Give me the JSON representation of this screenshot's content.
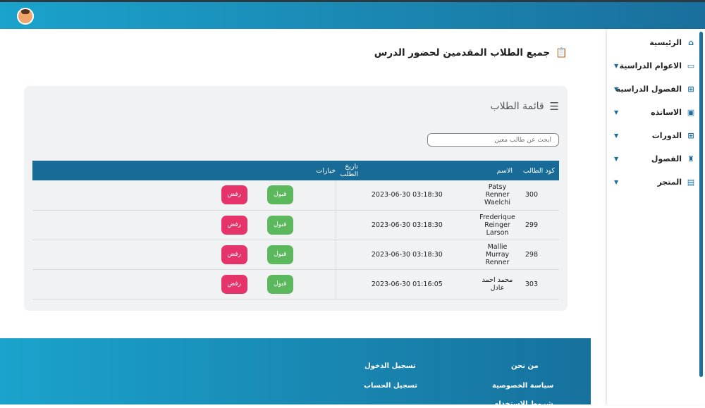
{
  "sidebar": {
    "items": [
      {
        "label": "الرئيسية",
        "icon": "home-icon",
        "caret": false
      },
      {
        "label": "الاعوام الدراسية",
        "icon": "folder-icon",
        "caret": true
      },
      {
        "label": "الفصول الدراسية",
        "icon": "sitemap-icon",
        "caret": true
      },
      {
        "label": "الاساتذه",
        "icon": "teacher-icon",
        "caret": true
      },
      {
        "label": "الدورات",
        "icon": "sitemap-icon",
        "caret": true
      },
      {
        "label": "الفصول",
        "icon": "institution-icon",
        "caret": true
      },
      {
        "label": "المتجر",
        "icon": "store-icon",
        "caret": true
      }
    ]
  },
  "page": {
    "title": "جميع الطلاب المقدمين لحضور الدرس"
  },
  "card": {
    "title": "قائمة الطلاب",
    "search_placeholder": "ابحث عن طالب معين"
  },
  "table": {
    "headers": [
      "كود الطالب",
      "الاسم",
      "تاريخ الطلب",
      "خيارات"
    ],
    "accept_label": "قبول",
    "reject_label": "رفض",
    "rows": [
      {
        "code": "300",
        "name": "Patsy Renner Waelchi",
        "date": "03:18:30 2023-06-30"
      },
      {
        "code": "299",
        "name": "Frederique Reinger Larson",
        "date": "03:18:30 2023-06-30"
      },
      {
        "code": "298",
        "name": "Mallie Murray Renner",
        "date": "03:18:30 2023-06-30"
      },
      {
        "code": "303",
        "name": "محمد احمد عادل",
        "date": "01:16:05 2023-06-30"
      }
    ]
  },
  "footer": {
    "links": [
      "من نحن",
      "سياسة الخصوصية",
      "شروط الاستخدام",
      "تسجيل الدخول",
      "تسجيل الحساب"
    ]
  }
}
